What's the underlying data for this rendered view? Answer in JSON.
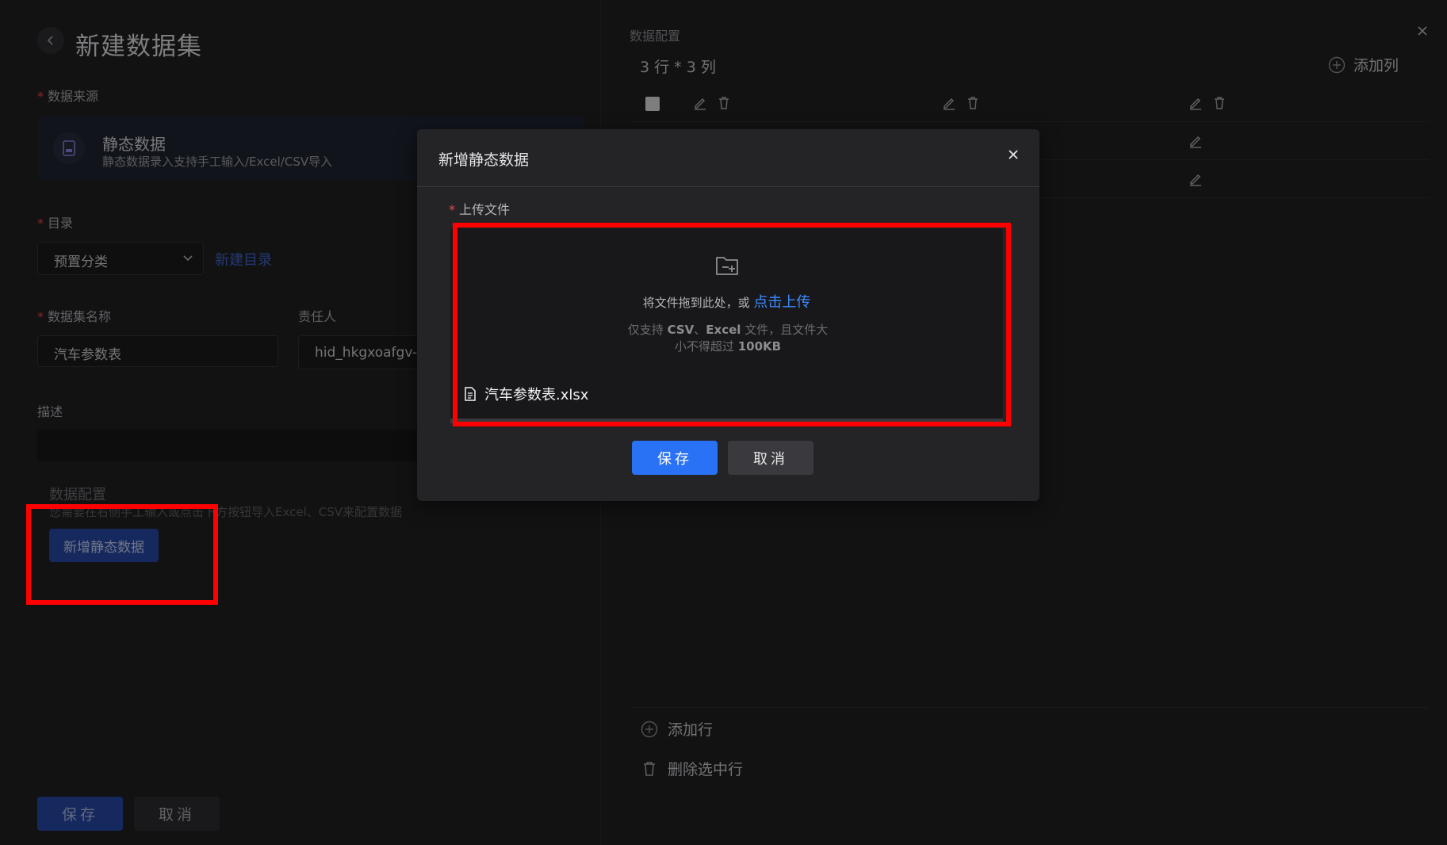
{
  "page": {
    "title": "新建数据集",
    "source_label": "数据来源",
    "source_card": {
      "title": "静态数据",
      "desc": "静态数据录入支持手工输入/Excel/CSV导入"
    },
    "directory_label": "目录",
    "directory_value": "预置分类",
    "new_directory_link": "新建目录",
    "dataset_name_label": "数据集名称",
    "dataset_name_value": "汽车参数表",
    "owner_label": "责任人",
    "owner_value": "hid_hkgxoafgv-y",
    "description_label": "描述",
    "data_config_title": "数据配置",
    "data_config_hint": "您需要在右侧手工输入或点击下方按钮导入Excel、CSV来配置数据",
    "add_static_button": "新增静态数据",
    "save_button": "保存",
    "cancel_button": "取消"
  },
  "right_panel": {
    "section_title": "数据配置",
    "dimensions": "3 行 * 3 列",
    "add_column": "添加列",
    "add_row": "添加行",
    "delete_selected": "删除选中行"
  },
  "modal": {
    "title": "新增静态数据",
    "upload_label": "上传文件",
    "drop_hint": "将文件拖到此处，或",
    "click_upload": "点击上传",
    "limit_line1_prefix": "仅支持 ",
    "limit_csv": "CSV",
    "limit_sep": "、",
    "limit_excel": "Excel",
    "limit_line1_suffix": " 文件，且文件大",
    "limit_line2_prefix": "小不得超过 ",
    "limit_size": "100KB",
    "file_name": "汽车参数表.xlsx",
    "save_button": "保存",
    "cancel_button": "取消"
  },
  "icons": {
    "back": "chevron-left-icon",
    "close": "close-icon",
    "add": "plus-circle-icon",
    "edit": "edit-icon",
    "delete": "trash-icon",
    "upload": "folder-add-icon",
    "file": "file-icon",
    "dropdown": "chevron-down-icon"
  },
  "colors": {
    "accent": "#2a72f5",
    "link": "#3d8bff",
    "required": "#e5484d",
    "annotation": "#ff0000"
  }
}
